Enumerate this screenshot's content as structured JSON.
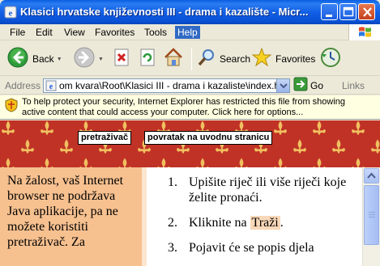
{
  "window": {
    "title": "Klasici hrvatske književnosti III - drama i kazalište - Micr..."
  },
  "menu": {
    "items": [
      "File",
      "Edit",
      "View",
      "Favorites",
      "Tools",
      "Help"
    ],
    "active": "Help"
  },
  "toolbar": {
    "back_label": "Back",
    "search_label": "Search",
    "favorites_label": "Favorites"
  },
  "address": {
    "label": "Address",
    "value": "om kvara\\Root\\Klasici III - drama i kazaliste\\index.htm",
    "go_label": "Go",
    "links_label": "Links"
  },
  "infobar": {
    "text": "To help protect your security, Internet Explorer has restricted this file from showing active content that could access your computer. Click here for options..."
  },
  "banner": {
    "search_button": "pretraživač",
    "home_button": "povratak na uvodnu stranicu"
  },
  "left_frame": {
    "message": "Na žalost, vaš Internet browser ne podržava Java aplikacije, pa ne možete koristiti pretraživač. Za"
  },
  "right_frame": {
    "steps": [
      {
        "number": "1.",
        "text": "Upišite riječ ili više riječi koje želite pronaći."
      },
      {
        "number": "2.",
        "text_before": "Kliknite na ",
        "highlight": "Traži",
        "text_after": "."
      },
      {
        "number": "3.",
        "text": "Pojavit će se popis djela"
      }
    ]
  },
  "colors": {
    "title_bar": "#0a5fe0",
    "banner_red": "#c03226",
    "fleur_gold": "#f0c060",
    "left_frame_bg": "#f6c08f",
    "highlight_bg": "#f8d8b8"
  },
  "icons": {
    "title": "ie-page-icon",
    "back": "back-arrow-icon",
    "forward": "forward-arrow-icon",
    "stop": "stop-icon",
    "refresh": "refresh-icon",
    "home": "home-icon",
    "search": "search-icon",
    "favorites": "favorites-star-icon",
    "history": "history-icon",
    "go": "go-arrow-icon",
    "security": "shield-icon",
    "windows_logo": "windows-logo-icon"
  }
}
